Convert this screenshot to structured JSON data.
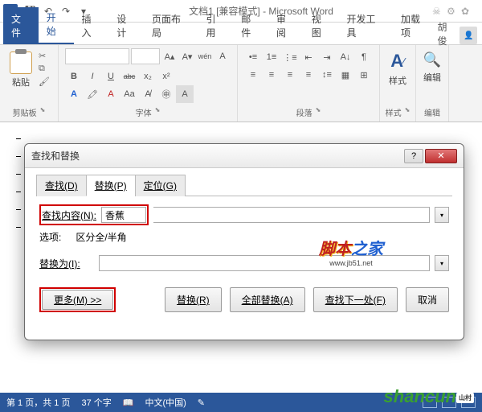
{
  "titlebar": {
    "app_title": "文档1 [兼容模式] - Microsoft Word"
  },
  "tabs": {
    "file": "文件",
    "items": [
      "开始",
      "插入",
      "设计",
      "页面布局",
      "引用",
      "邮件",
      "审阅",
      "视图",
      "开发工具",
      "加载项"
    ],
    "username": "胡俊"
  },
  "ribbon": {
    "clipboard": {
      "paste": "粘贴",
      "label": "剪贴板"
    },
    "font": {
      "label": "字体",
      "family": "",
      "size": "",
      "buttons": [
        "B",
        "I",
        "U",
        "abc",
        "x₂",
        "x²"
      ],
      "buttons2": [
        "A",
        "⁄",
        "A",
        "Aa",
        "A",
        "A",
        "A"
      ]
    },
    "paragraph": {
      "label": "段落"
    },
    "styles": {
      "label": "样式",
      "btn": "样式"
    },
    "editing": {
      "label": "编辑",
      "btn": "编辑"
    }
  },
  "dialog": {
    "title": "查找和替换",
    "tabs": {
      "find": "查找(D)",
      "replace": "替换(P)",
      "goto": "定位(G)"
    },
    "find_label": "查找内容(N):",
    "find_value": "香蕉",
    "options_label": "选项:",
    "options_value": "区分全/半角",
    "replace_label": "替换为(I):",
    "replace_value": "",
    "buttons": {
      "more": "更多(M) >>",
      "replace": "替换(R)",
      "replace_all": "全部替换(A)",
      "find_next": "查找下一处(F)",
      "cancel": "取消"
    }
  },
  "watermark": {
    "text1": "脚本",
    "text2": "之家",
    "sub": "www.jb51.net"
  },
  "statusbar": {
    "page": "第 1 页，共 1 页",
    "words": "37 个字",
    "lang": "中文(中国)"
  },
  "shancun": {
    "text": "shancun",
    "sub": "山村"
  }
}
